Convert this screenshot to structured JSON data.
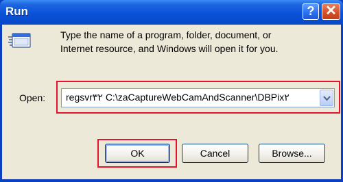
{
  "window": {
    "title": "Run",
    "help_glyph": "?",
    "close_glyph": "✕"
  },
  "description": {
    "line1": "Type the name of a program, folder, document, or",
    "line2": "Internet resource, and Windows will open it for you."
  },
  "open_field": {
    "label": "Open:",
    "value": "regsvr۳۲ C:\\zaCaptureWebCamAndScanner\\DBPix۲",
    "dropdown_icon": "chevron-down-icon"
  },
  "buttons": {
    "ok": "OK",
    "cancel": "Cancel",
    "browse": "Browse..."
  },
  "colors": {
    "titlebar": "#0a52d8",
    "dialog_bg": "#ece9d8",
    "highlight_box": "#e8102a"
  },
  "icons": {
    "run": "run-program-icon",
    "help": "help-icon",
    "close": "close-icon"
  }
}
